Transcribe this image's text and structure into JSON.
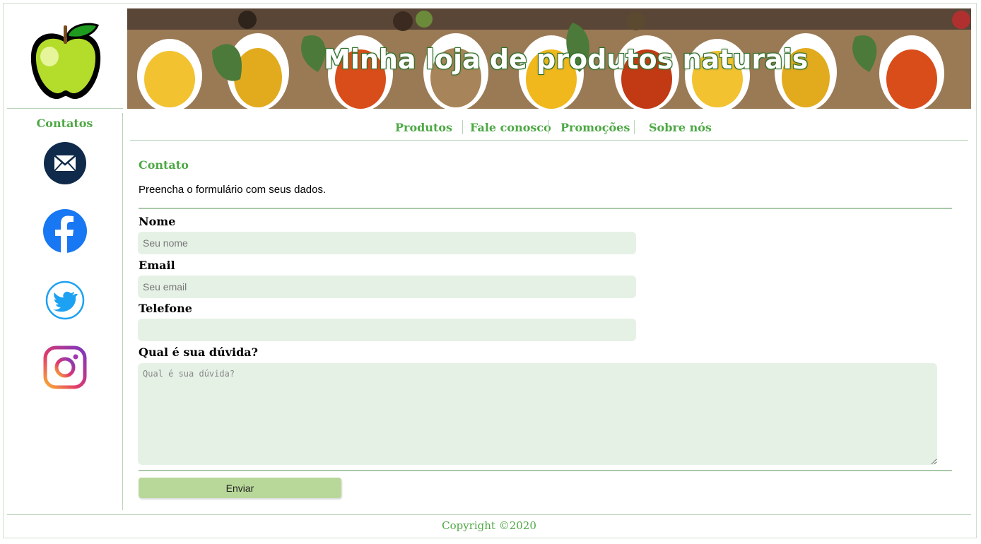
{
  "header": {
    "banner_title": "Minha loja de produtos naturais"
  },
  "sidebar": {
    "title": "Contatos",
    "icons": [
      "mail-icon",
      "facebook-icon",
      "twitter-icon",
      "instagram-icon"
    ]
  },
  "nav": {
    "items": [
      "Produtos",
      "Fale conosco",
      "Promoções",
      "Sobre nós"
    ]
  },
  "main": {
    "title": "Contato",
    "intro": "Preencha o formulário com seus dados.",
    "form": {
      "name_label": "Nome",
      "name_placeholder": "Seu nome",
      "email_label": "Email",
      "email_placeholder": "Seu email",
      "phone_label": "Telefone",
      "phone_placeholder": "",
      "question_label": "Qual é sua dúvida?",
      "question_placeholder": "Qual é sua dúvida?",
      "submit_label": "Enviar"
    }
  },
  "footer": {
    "copyright": "Copyright ©2020"
  },
  "colors": {
    "accent": "#4ea845",
    "field_bg": "#e6f1e6",
    "button_bg": "#b8d89a"
  }
}
